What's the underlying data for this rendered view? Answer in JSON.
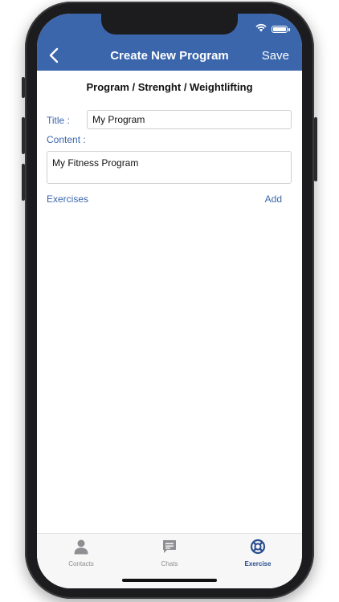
{
  "header": {
    "title": "Create New Program",
    "save_label": "Save",
    "background_color": "#3b66ac"
  },
  "breadcrumb": "Program / Strenght / Weightlifting",
  "form": {
    "title_label": "Title :",
    "title_value": "My Program",
    "content_label": "Content :",
    "content_value": "My Fitness Program"
  },
  "exercises": {
    "label": "Exercises",
    "add_label": "Add"
  },
  "tabbar": {
    "items": [
      {
        "label": "Contacts",
        "icon": "person-icon",
        "active": false
      },
      {
        "label": "Chats",
        "icon": "chat-bubble-icon",
        "active": false
      },
      {
        "label": "Exercise",
        "icon": "lifebuoy-icon",
        "active": true
      }
    ],
    "active_color": "#2c4f8f",
    "inactive_color": "#8e8e93"
  },
  "status_bar": {
    "icons": [
      "wifi-icon",
      "battery-icon"
    ]
  }
}
